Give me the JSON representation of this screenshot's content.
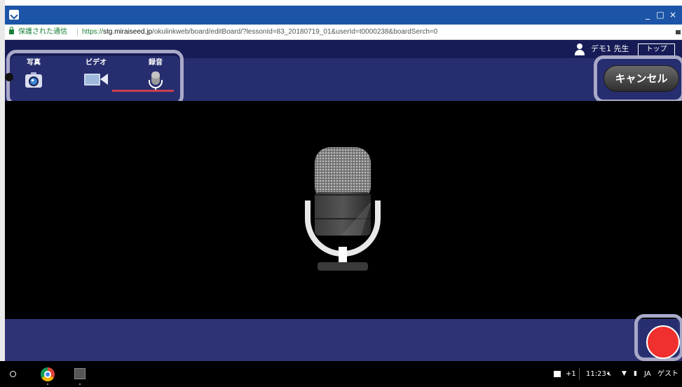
{
  "window": {
    "minimize_glyph": "_",
    "maximize_glyph": "□",
    "close_glyph": "×"
  },
  "address_bar": {
    "secure_label": "保護された通信",
    "url_protocol": "https://",
    "url_host": "stg.miraiseed.jp",
    "url_path": "/okulinkweb/board/editBoard/?lessonId=83_20180719_01&userId=t0000238&boardSerch=0"
  },
  "header": {
    "user_name": "デモ1 先生",
    "top_button_label": "トップ"
  },
  "toolbar": {
    "media_buttons": [
      {
        "label": "写真",
        "icon": "camera-icon"
      },
      {
        "label": "ビデオ",
        "icon": "video-camera-icon"
      },
      {
        "label": "録音",
        "icon": "microphone-icon",
        "selected": true
      }
    ],
    "cancel_label": "キャンセル"
  },
  "main": {
    "center_icon": "microphone-icon"
  },
  "record": {
    "icon": "record-button",
    "color": "#f0302e"
  },
  "shelf": {
    "apps": [
      "launcher-icon",
      "chrome-icon",
      "app-icon"
    ],
    "notification_count": "+1",
    "time": "11:23",
    "ime": "JA",
    "user": "ゲスト"
  },
  "colors": {
    "titlebar": "#1c55a8",
    "header": "#171c57",
    "toolbar": "#272e6f",
    "bottom_bar": "#2d3374",
    "highlight_frame": "#a9a9c8",
    "selected_underline": "#c9404d"
  }
}
